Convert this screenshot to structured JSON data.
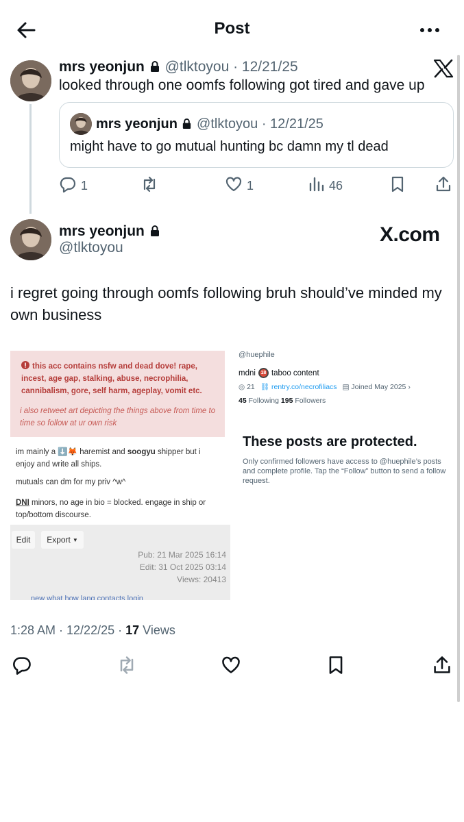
{
  "header": {
    "title": "Post"
  },
  "parent_post": {
    "display_name": "mrs yeonjun",
    "handle": "@tlktoyou",
    "date": "· 12/21/25",
    "text": "looked through one oomfs following got tired and gave up",
    "quote": {
      "display_name": "mrs yeonjun",
      "handle": "@tlktoyou",
      "date": "· 12/21/25",
      "text": "might have to go mutual hunting bc damn my tl dead"
    },
    "actions": {
      "replies": "1",
      "likes": "1",
      "views": "46"
    }
  },
  "main_post": {
    "display_name": "mrs yeonjun",
    "handle": "@tlktoyou",
    "watermark": "X.com",
    "text": "i regret going through oomfs following bruh should’ve minded my own business",
    "timestamp": "1:28 AM · 12/22/25 · ",
    "views_count": "17",
    "views_label": " Views"
  },
  "embed_left": {
    "warning": "this acc contains nsfw and dead dove! rape, incest, age gap, stalking, abuse, necrophilia, cannibalism, gore, self harm, ageplay, vomit etc.",
    "warning_note": "i also retweet art depicting the things above from time to time so follow at ur own risk",
    "bio_1_a": "im mainly a ",
    "bio_1_emoji": "⬇️🦊",
    "bio_1_b": " haremist and ",
    "bio_1_bold": "soogyu",
    "bio_1_c": " shipper but i enjoy and write all ships.",
    "bio_2": "mutuals can dm for my priv ^w^",
    "bio_3_bold": "DNI",
    "bio_3": " minors, no age in bio = blocked. engage in ship or top/bottom discourse.",
    "btn_edit": "Edit",
    "btn_export": "Export",
    "pub": "Pub: 21 Mar 2025 16:14",
    "edit": "Edit: 31 Oct 2025 03:14",
    "views": "Views: 20413",
    "cutoff_links": "new   what   how   lang   contacts   login"
  },
  "embed_right": {
    "handle": "@huephile",
    "bio_a": "mdni",
    "badge": "18",
    "bio_b": "taboo content",
    "loc": "21",
    "link": "rentry.co/necrofiliacs",
    "joined": "Joined May 2025",
    "following_count": "45",
    "following_label": " Following  ",
    "followers_count": "195",
    "followers_label": " Followers",
    "protected_title": "These posts are protected.",
    "protected_sub": "Only confirmed followers have access to @huephile’s posts and complete profile. Tap the “Follow” button to send a follow request."
  }
}
